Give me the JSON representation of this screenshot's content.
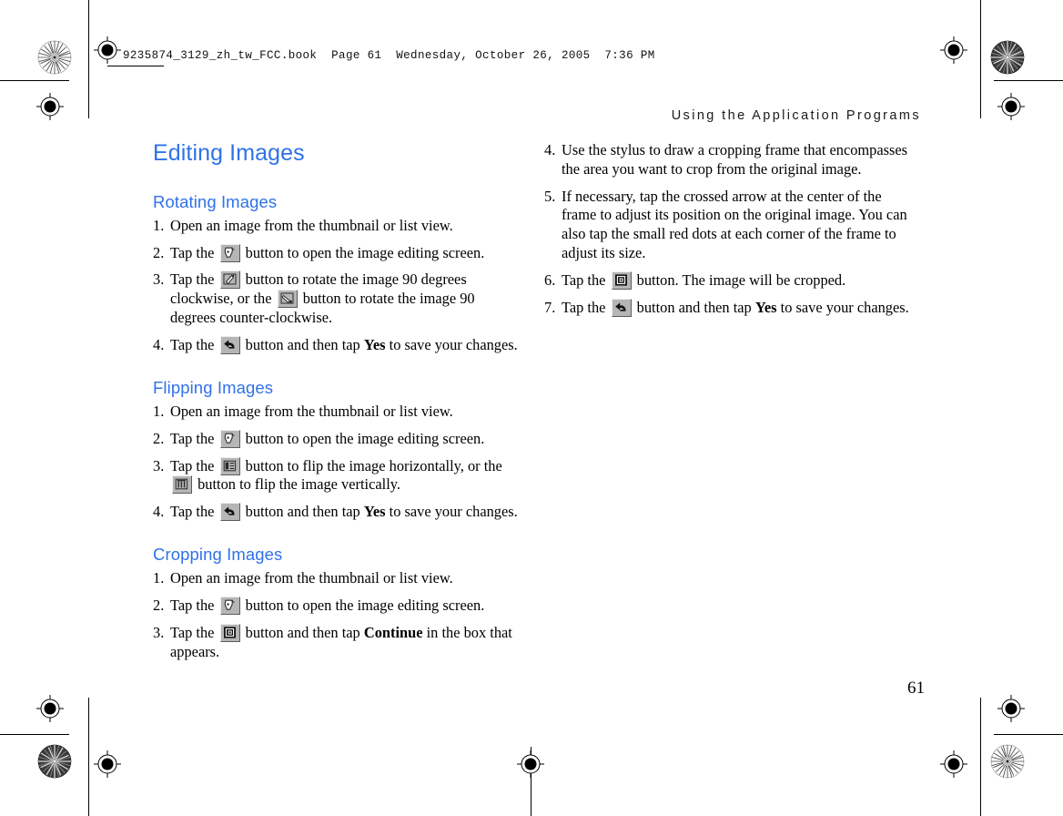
{
  "print_marks": {
    "slug_line": "9235874_3129_zh_tw_FCC.book  Page 61  Wednesday, October 26, 2005  7:36 PM",
    "registration_icon": "registration-target-icon",
    "star_target_icon": "star-density-target-icon"
  },
  "page": {
    "running_head": "Using the Application Programs",
    "page_number": "61",
    "heading_color": "#2f72e8"
  },
  "left_column": {
    "title": "Editing Images",
    "sections": [
      {
        "heading": "Rotating Images",
        "steps": [
          {
            "num": "1.",
            "parts": [
              {
                "type": "text",
                "value": "Open an image from the thumbnail or list view."
              }
            ]
          },
          {
            "num": "2.",
            "parts": [
              {
                "type": "text",
                "value": "Tap the "
              },
              {
                "type": "icon",
                "value": "edit-image-icon"
              },
              {
                "type": "text",
                "value": " button to open the image editing screen."
              }
            ]
          },
          {
            "num": "3.",
            "parts": [
              {
                "type": "text",
                "value": "Tap the "
              },
              {
                "type": "icon",
                "value": "rotate-clockwise-icon"
              },
              {
                "type": "text",
                "value": " button to rotate the image 90 degrees clockwise, or the "
              },
              {
                "type": "icon",
                "value": "rotate-counter-clockwise-icon"
              },
              {
                "type": "text",
                "value": " button to rotate the image 90 degrees counter-clockwise."
              }
            ]
          },
          {
            "num": "4.",
            "parts": [
              {
                "type": "text",
                "value": "Tap the "
              },
              {
                "type": "icon",
                "value": "back-arrow-icon"
              },
              {
                "type": "text",
                "value": " button and then tap "
              },
              {
                "type": "bold",
                "value": "Yes"
              },
              {
                "type": "text",
                "value": " to save your changes."
              }
            ]
          }
        ]
      },
      {
        "heading": "Flipping Images",
        "steps": [
          {
            "num": "1.",
            "parts": [
              {
                "type": "text",
                "value": "Open an image from the thumbnail or list view."
              }
            ]
          },
          {
            "num": "2.",
            "parts": [
              {
                "type": "text",
                "value": "Tap the "
              },
              {
                "type": "icon",
                "value": "edit-image-icon"
              },
              {
                "type": "text",
                "value": " button to open the image editing screen."
              }
            ]
          },
          {
            "num": "3.",
            "parts": [
              {
                "type": "text",
                "value": "Tap the "
              },
              {
                "type": "icon",
                "value": "flip-horizontal-icon"
              },
              {
                "type": "text",
                "value": " button to flip the image horizontally, or the "
              },
              {
                "type": "icon",
                "value": "flip-vertical-icon"
              },
              {
                "type": "text",
                "value": " button to flip the image vertically."
              }
            ]
          },
          {
            "num": "4.",
            "parts": [
              {
                "type": "text",
                "value": "Tap the "
              },
              {
                "type": "icon",
                "value": "back-arrow-icon"
              },
              {
                "type": "text",
                "value": " button and then tap "
              },
              {
                "type": "bold",
                "value": "Yes"
              },
              {
                "type": "text",
                "value": " to save your changes."
              }
            ]
          }
        ]
      },
      {
        "heading": "Cropping Images",
        "steps": [
          {
            "num": "1.",
            "parts": [
              {
                "type": "text",
                "value": "Open an image from the thumbnail or list view."
              }
            ]
          },
          {
            "num": "2.",
            "parts": [
              {
                "type": "text",
                "value": "Tap the "
              },
              {
                "type": "icon",
                "value": "edit-image-icon"
              },
              {
                "type": "text",
                "value": " button to open the image editing screen."
              }
            ]
          },
          {
            "num": "3.",
            "parts": [
              {
                "type": "text",
                "value": "Tap the "
              },
              {
                "type": "icon",
                "value": "crop-icon"
              },
              {
                "type": "text",
                "value": " button and then tap "
              },
              {
                "type": "bold",
                "value": "Continue"
              },
              {
                "type": "text",
                "value": " in the box that appears."
              }
            ]
          }
        ]
      }
    ]
  },
  "right_column": {
    "sections": [
      {
        "heading": "",
        "steps": [
          {
            "num": "4.",
            "parts": [
              {
                "type": "text",
                "value": "Use the stylus to draw a cropping frame that encompasses the area you want to crop from the original image."
              }
            ]
          },
          {
            "num": "5.",
            "parts": [
              {
                "type": "text",
                "value": "If necessary, tap the crossed arrow at the center of the frame to adjust its position on the original image. You can also tap the small red dots at each corner of the frame to adjust its size."
              }
            ]
          },
          {
            "num": "6.",
            "parts": [
              {
                "type": "text",
                "value": "Tap the "
              },
              {
                "type": "icon",
                "value": "crop-icon"
              },
              {
                "type": "text",
                "value": " button. The image will be cropped."
              }
            ]
          },
          {
            "num": "7.",
            "parts": [
              {
                "type": "text",
                "value": "Tap the "
              },
              {
                "type": "icon",
                "value": "back-arrow-icon"
              },
              {
                "type": "text",
                "value": " button and then tap "
              },
              {
                "type": "bold",
                "value": "Yes"
              },
              {
                "type": "text",
                "value": " to save your changes."
              }
            ]
          }
        ]
      }
    ]
  }
}
